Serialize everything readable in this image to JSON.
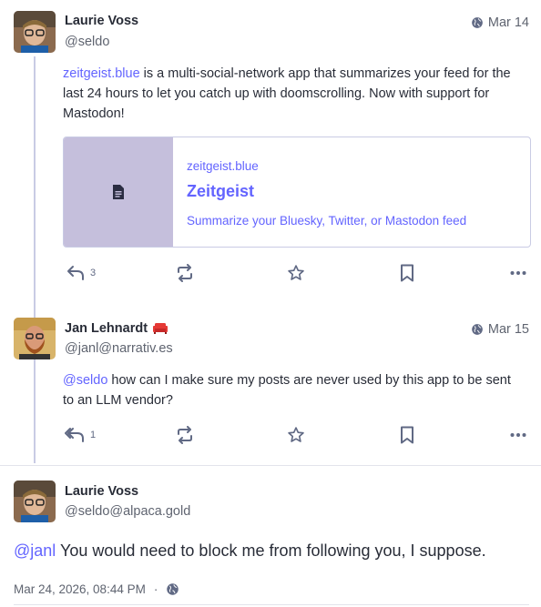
{
  "posts": [
    {
      "display_name": "Laurie Voss",
      "handle": "@seldo",
      "date": "Mar 14",
      "link_text": "zeitgeist.blue",
      "text_rest": " is a multi-social-network app that summarizes your feed for the last 24 hours to let you catch up with doomscrolling. Now with support for Mastodon!",
      "card": {
        "host": "zeitgeist.blue",
        "title": "Zeitgeist",
        "description": "Summarize your Bluesky, Twitter, or Mastodon feed"
      },
      "reply_count": "3"
    },
    {
      "display_name": "Jan Lehnardt",
      "handle": "@janl@narrativ.es",
      "date": "Mar 15",
      "mention": "@seldo",
      "text_rest": " how can I make sure my posts are never used by this app to be sent to an LLM vendor?",
      "reply_count": "1"
    }
  ],
  "focused_post": {
    "display_name": "Laurie Voss",
    "handle": "@seldo@alpaca.gold",
    "mention": "@janl",
    "text_rest": " You would need to block me from following you, I suppose.",
    "timestamp": "Mar 24, 2026, 08:44 PM",
    "separator": "·"
  },
  "colors": {
    "accent": "#6364ff",
    "thread_line": "#c9cbe4",
    "card_thumb": "#c5bfdc",
    "badge": "#e53935"
  },
  "icons": [
    "globe-icon",
    "reply-icon",
    "reply-all-icon",
    "boost-icon",
    "star-icon",
    "bookmark-icon",
    "more-icon",
    "document-icon",
    "couch-icon"
  ]
}
